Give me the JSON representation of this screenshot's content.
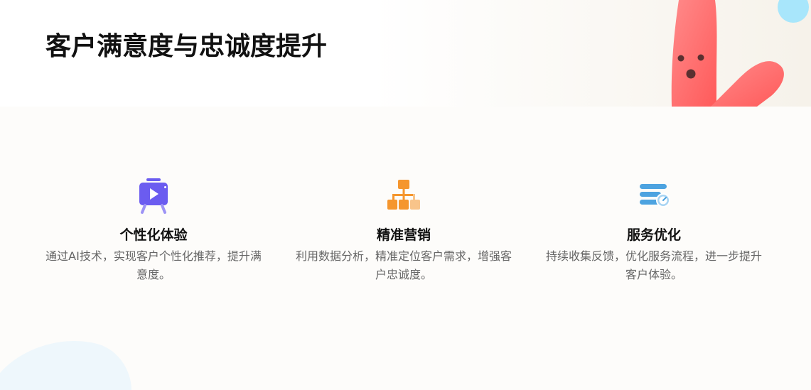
{
  "header": {
    "title": "客户满意度与忠诚度提升"
  },
  "colors": {
    "accent_purple": "#6b5cf0",
    "accent_orange": "#f5962e",
    "accent_blue": "#4da3e0",
    "mascot": "#ff6b6b"
  },
  "features": [
    {
      "icon": "presentation-play-icon",
      "title": "个性化体验",
      "desc": "通过AI技术，实现客户个性化推荐，提升满意度。"
    },
    {
      "icon": "org-chart-icon",
      "title": "精准营销",
      "desc": "利用数据分析，精准定位客户需求，增强客户忠诚度。"
    },
    {
      "icon": "server-gauge-icon",
      "title": "服务优化",
      "desc": "持续收集反馈，优化服务流程，进一步提升客户体验。"
    }
  ]
}
